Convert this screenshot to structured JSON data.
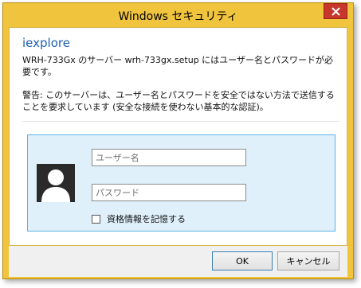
{
  "window": {
    "title": "Windows セキュリティ",
    "close_icon": "close-icon"
  },
  "dialog": {
    "app_name": "iexplore",
    "message": "WRH-733Gx のサーバー wrh-733gx.setup にはユーザー名とパスワードが必要です。",
    "warning": "警告: このサーバーは、ユーザー名とパスワードを安全ではない方法で送信することを要求しています (安全な接続を使わない基本的な認証)。"
  },
  "credentials": {
    "avatar_icon": "user-avatar-icon",
    "username_placeholder": "ユーザー名",
    "username_value": "",
    "password_placeholder": "パスワード",
    "password_value": "",
    "remember_label": "資格情報を記憶する",
    "remember_checked": false
  },
  "buttons": {
    "ok_label": "OK",
    "cancel_label": "キャンセル"
  },
  "colors": {
    "title_bar": "#f0c43c",
    "close_button": "#c7372b",
    "app_name": "#1d60b3",
    "credential_panel": "#dff0fb",
    "credential_border": "#5fb2e5"
  }
}
